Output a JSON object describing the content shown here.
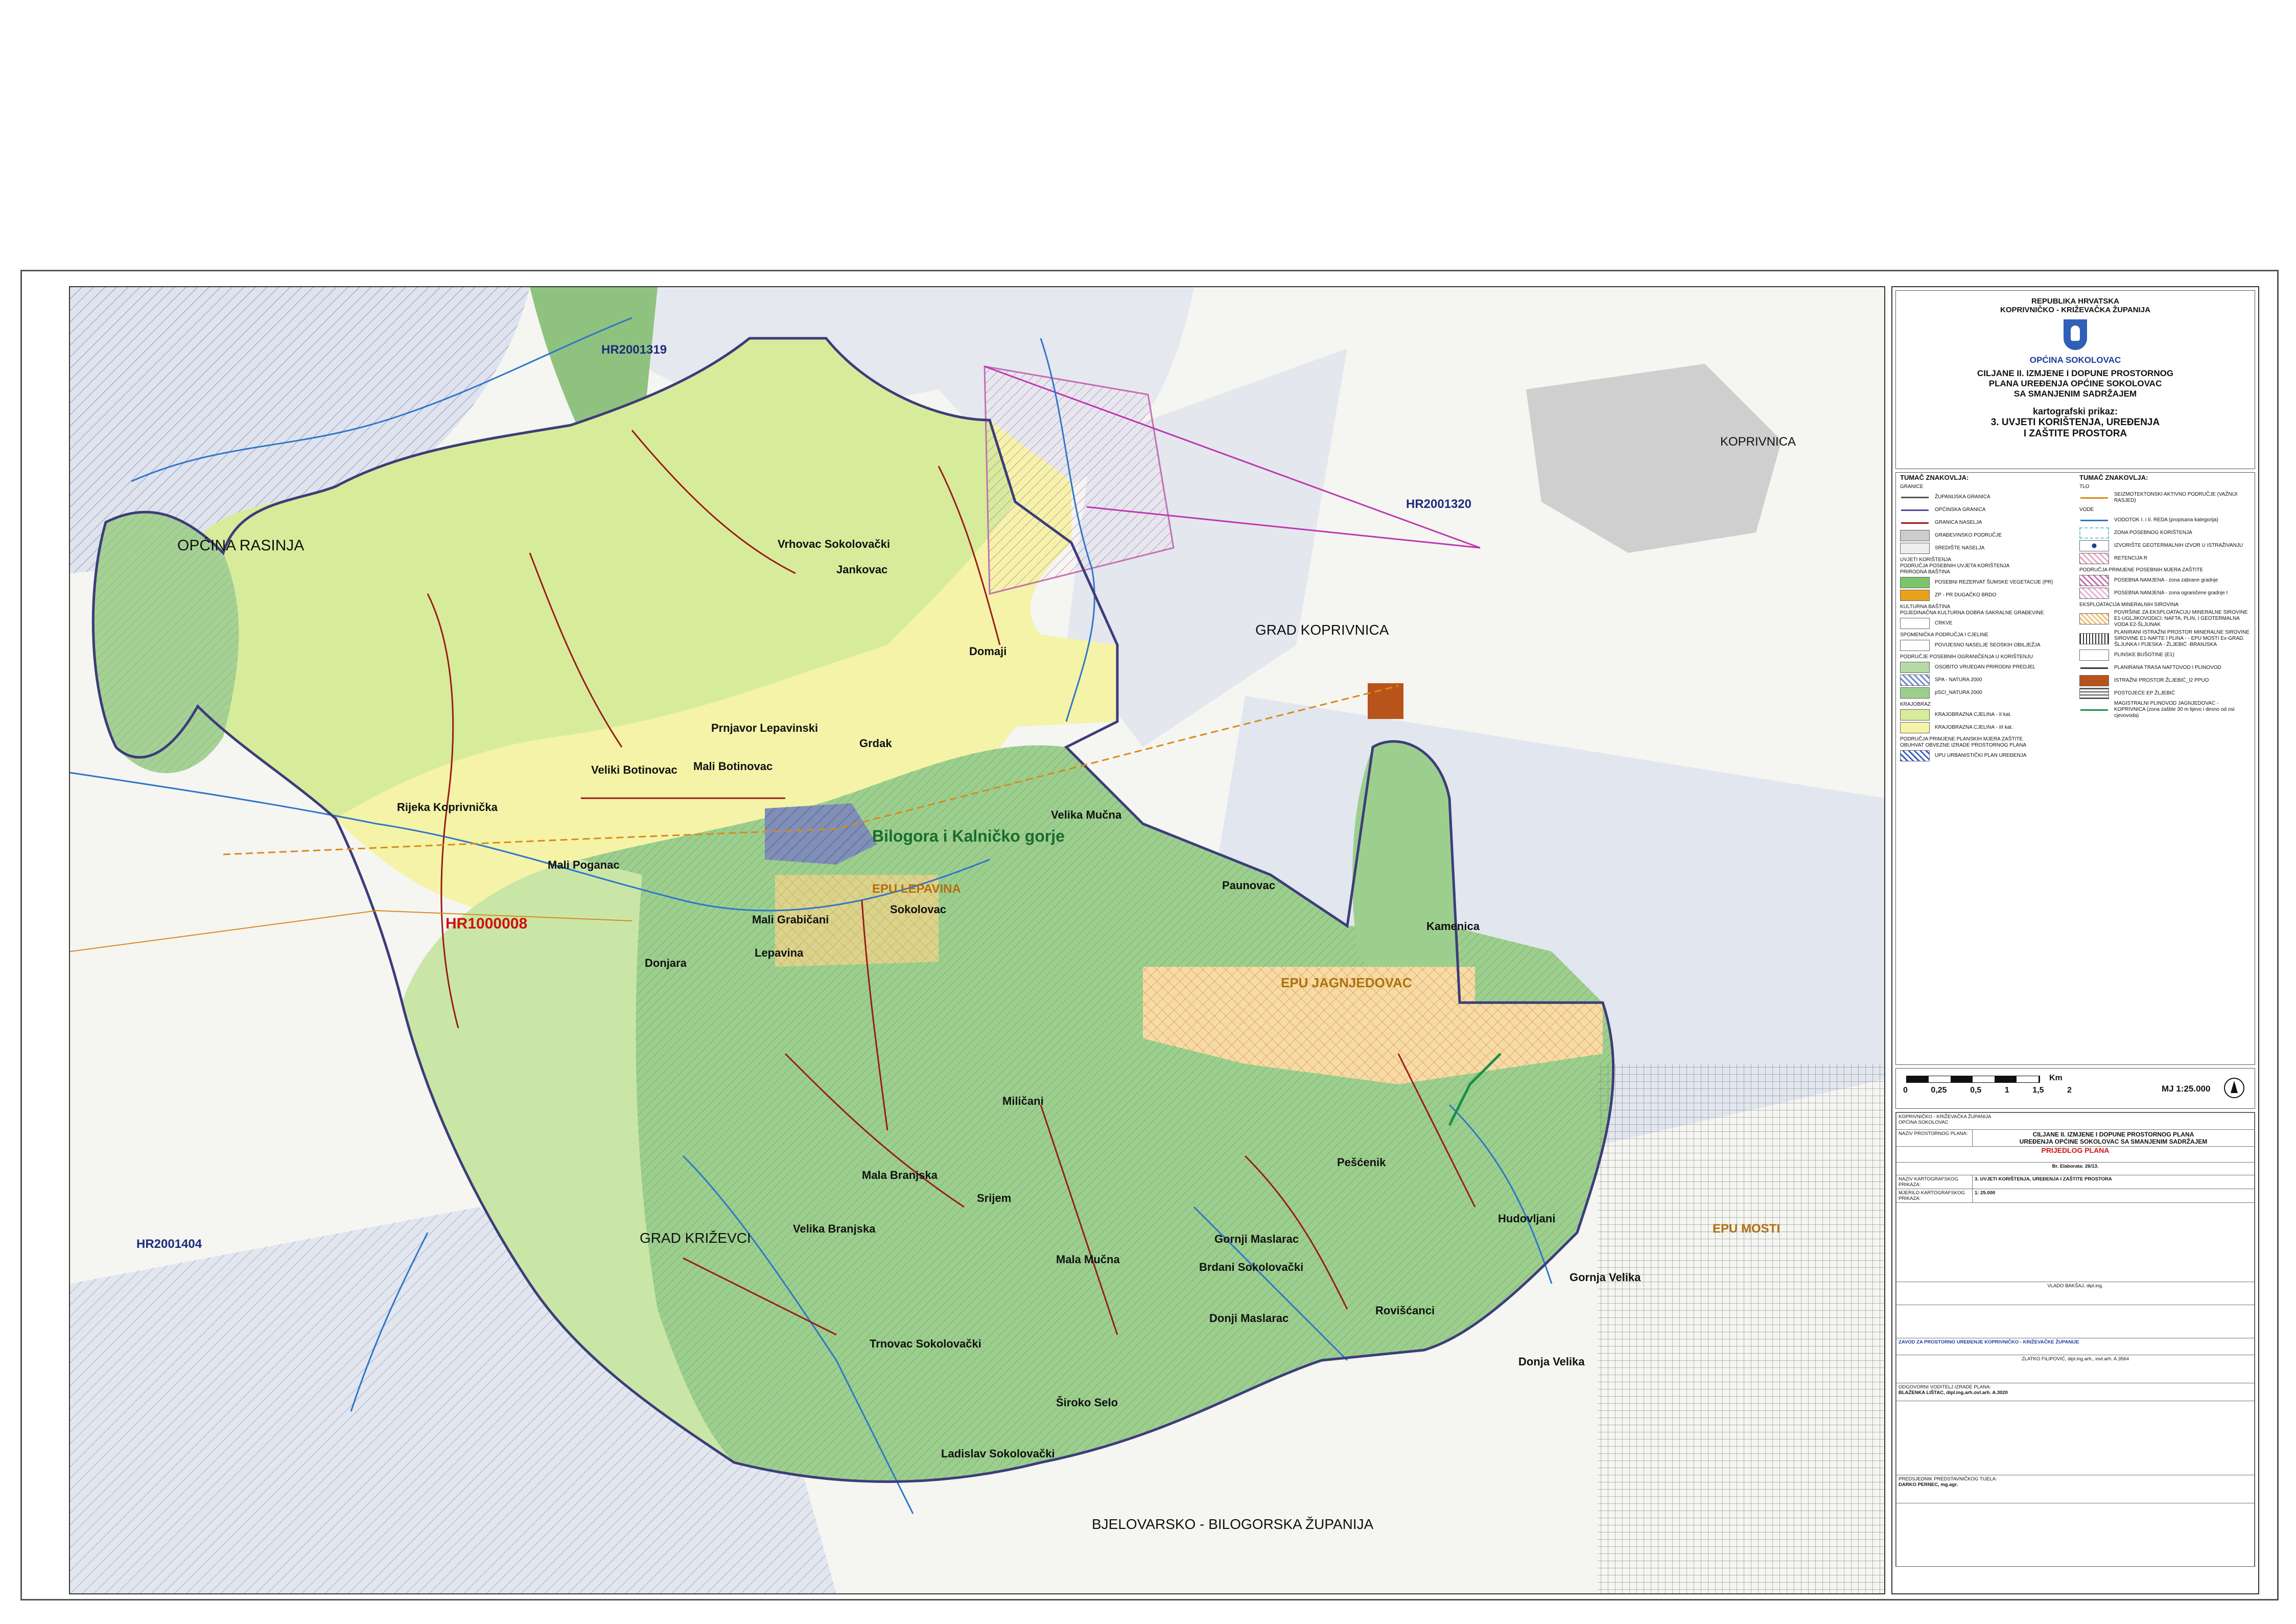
{
  "header": {
    "republic": "REPUBLIKA HRVATSKA",
    "county": "KOPRIVNIČKO - KRIŽEVAČKA ŽUPANIJA",
    "municipality": "OPĆINA SOKOLOVAC",
    "title_lines": [
      "CILJANE II. IZMJENE I DOPUNE PROSTORNOG",
      "PLANA UREĐENJA OPĆINE SOKOLOVAC",
      "SA SMANJENIM SADRŽAJEM"
    ],
    "map_kind": "kartografski prikaz:",
    "map_name_lines": [
      "3. UVJETI KORIŠTENJA, UREĐENJA",
      "I ZAŠTITE PROSTORA"
    ]
  },
  "map": {
    "labels": {
      "opcina_rasinja": "OPĆINA RASINJA",
      "grad_koprivnica": "GRAD KOPRIVNICA",
      "koprivnica": "KOPRIVNICA",
      "grad_krizevci": "GRAD KRIŽEVCI",
      "bjelovarsko": "BJELOVARSKO - BILOGORSKA ŽUPANIJA",
      "natura_bilogora": "Bilogora i Kalničko gorje",
      "epu_lepavina": "EPU LEPAVINA",
      "epu_jagnjedovac": "EPU JAGNJEDOVAC",
      "epu_mosti": "EPU MOSTI",
      "hr1000008": "HR1000008",
      "hr2001319": "HR2001319",
      "hr2001320": "HR2001320",
      "hr2001404": "HR2001404"
    },
    "settlements": [
      "Vrhovac Sokolovački",
      "Jankovac",
      "Domaji",
      "Prnjavor Lepavinski",
      "Grdak",
      "Veliki Botinovac",
      "Mali Botinovac",
      "Rijeka Koprivnička",
      "Mali Poganac",
      "Velika Mučna",
      "Sokolovac",
      "Mali Grabičani",
      "Lepavina",
      "Donjara",
      "Paunovac",
      "Kamenica",
      "Miličani",
      "Mala Branjska",
      "Srijem",
      "Velika Branjska",
      "Pešćenik",
      "Mala Mučna",
      "Gornji Maslarac",
      "Brdani Sokolovački",
      "Hudovljani",
      "Donji Maslarac",
      "Rovišćanci",
      "Gornja Velika",
      "Trnovac Sokolovački",
      "Široko Selo",
      "Donja Velika",
      "Ladislav Sokolovački"
    ]
  },
  "legend": {
    "left_title": "TUMAČ ZNAKOVLJA:",
    "right_title": "TUMAČ ZNAKOVLJA:",
    "granice_title": "GRANICE",
    "left_items": [
      {
        "label": "ŽUPANIJSKA GRANICA",
        "color": "#555555"
      },
      {
        "label": "OPĆINSKA GRANICA",
        "color": "#4a4a9a"
      },
      {
        "label": "GRANICA NASELJA",
        "color": "#9a1a1a"
      },
      {
        "label": "GRAĐEVINSKO PODRUČJE",
        "color": "#cccccc"
      },
      {
        "label": "SREDIŠTE NASELJA",
        "color": "#eeeeee"
      },
      {
        "label": "POSEBNI REZERVAT ŠUMSKE VEGETACIJE (PR)",
        "color": "#7cc46a"
      },
      {
        "label": "ZP - PR DUGAČKO BRDO",
        "color": "#e8a21a"
      },
      {
        "label": "CRKVE",
        "color": "#ffffff"
      },
      {
        "label": "POVIJESNO NASELJE SEOSKIH OBILJEŽJA",
        "color": "#ffffff"
      },
      {
        "label": "OSOBITO VRIJEDAN PRIRODNI PREDJEL",
        "color": "#b7d9a8"
      },
      {
        "label": "SPA - NATURA 2000",
        "color": "#6c86c8"
      },
      {
        "label": "pSCI_NATURA 2000",
        "color": "#9ccf8e"
      },
      {
        "label": "KRAJOBRAZNA CJELINA - II kat.",
        "color": "#d7ec9b"
      },
      {
        "label": "KRAJOBRAZNA CJELINA - III kat.",
        "color": "#f4f3a8"
      },
      {
        "label": "UPU URBANISTIČKI PLAN UREĐENJA",
        "color": "#3b5fc0"
      }
    ],
    "left_headings": [
      "UVJETI KORIŠTENJA",
      "PODRUČJA POSEBNIH UVJETA KORIŠTENJA",
      "PRIRODNA BAŠTINA",
      "KULTURNA BAŠTINA",
      "POJEDINAČNA KULTURNA DOBRA SAKRALNE GRAĐEVINE",
      "SPOMENIČKA PODRUČJA I CJELINE",
      "PODRUČJE POSEBNIH OGRANIČENJA U KORIŠTENJU",
      "KRAJOBRAZ",
      "PODRUČJA PRIMJENE PLANSKIH MJERA ZAŠTITE",
      "OBUHVAT OBVEZNE IZRADE PROSTORNOG PLANA"
    ],
    "right_headings": [
      "TLO",
      "VODE",
      "PODRUČJA PRIMJENE POSEBNIH MJERA ZAŠTITE",
      "EKSPLOATACIJA MINERALNIH SIROVINA"
    ],
    "right_items": [
      {
        "label": "SEIZMOTEKTONSKI AKTIVNO PODRUČJE (VAŽNIJI RASJED)",
        "color": "#d98a1a"
      },
      {
        "label": "VODOTOK I. i II. REDA (propisana kategorija)",
        "color": "#2f76c9"
      },
      {
        "label": "ZONA POSEBNOG KORIŠTENJA",
        "color": "#6fc7e0"
      },
      {
        "label": "IZVORIŠTE GEOTERMALNIH IZVOR U ISTRAŽIVANJU",
        "color": "#1f3c9c"
      },
      {
        "label": "RETENCIJA R",
        "color": "#e2a7c9"
      },
      {
        "label": "POSEBNA NAMJENA - zona zabrane gradnje",
        "color": "#c36fb2"
      },
      {
        "label": "POSEBNA NAMJENA - zona ograničene gradnje I",
        "color": "#e6b3d9"
      },
      {
        "label": "POVRŠINE ZA EKSPLOATACIJU MINERALNE SIROVINE E1-UGLJIKOVODICI: NAFTA, PLIN, I GEOTERMALNA VODA E2-ŠLJUNAK",
        "color": "#f0c074"
      },
      {
        "label": "PLANIRANI ISTRAŽNI PROSTOR MINERALNE SIROVINE SIROVINE E1-NAFTE I PLINA - - EPU MOSTI Ex-GRAD. ŠLJUNKA I PIJESKA - ŽLJEBIĆ -BRANJSKA",
        "color": "#333333"
      },
      {
        "label": "PLINSKE BUŠOTINE (E1)",
        "color": "#ffffff"
      },
      {
        "label": "PLANIRANA TRASA NAFTOVOD I PLINOVOD",
        "color": "#333333"
      },
      {
        "label": "ISTRAŽNI PROSTOR ŽLJEBIĆ_I2 PPUO",
        "color": "#b8541b"
      },
      {
        "label": "POSTOJEĆE EP ŽLJEBIĆ",
        "color": "#555555"
      },
      {
        "label": "MAGISTRALNI PLINOVOD JAGNJEDOVAC - KOPRIVNICA (zona zaštite 30 m lijevo i desno od osi cjevovoda)",
        "color": "#1a8f4a"
      }
    ],
    "scale_ticks": [
      "0",
      "0,25",
      "0,5",
      "1",
      "1,5",
      "2"
    ],
    "scale_unit": "Km",
    "scale_ratio": "MJ 1:25.000"
  },
  "titleblock": {
    "lines": [
      "KOPRIVNIČKO - KRIŽEVAČKA ŽUPANIJA",
      "OPĆINA SOKOLOVAC",
      "NAZIV PROSTORNOG PLANA:",
      "CILJANE II. IZMJENE I DOPUNE PROSTORNOG PLANA",
      "UREĐENJA OPĆINE SOKOLOVAC SA SMANJENIM SADRŽAJEM",
      "PRIJEDLOG PLANA",
      "Br. Elaborata: 26/13.",
      "NAZIV KARTOGRAFSKOG PRIKAZA:",
      "3. UVJETI KORIŠTENJA, UREĐENJA I ZAŠTITE PROSTORA",
      "MJERILO KARTOGRAFSKOG PRIKAZA:",
      "1: 25.000",
      "VLADO BAKŠAJ, dipl.ing.",
      "ZAVOD ZA PROSTORNO UREĐENJE KOPRIVNIČKO - KRIŽEVAČKE ŽUPANIJE",
      "ZLATKO FILIPOVIĆ, dipl.ing.arh., iovl.arh. A.3564",
      "ODGOVORNI VODITELJ IZRADE PLANA:",
      "BLAŽENKA LIŠTAC, dipl.ing.arh.ovl.arh. A.3020",
      "PREDSJEDNIK PREDSTAVNIČKOG TIJELA:",
      "DARKO PERNEC, mg.agr."
    ]
  }
}
